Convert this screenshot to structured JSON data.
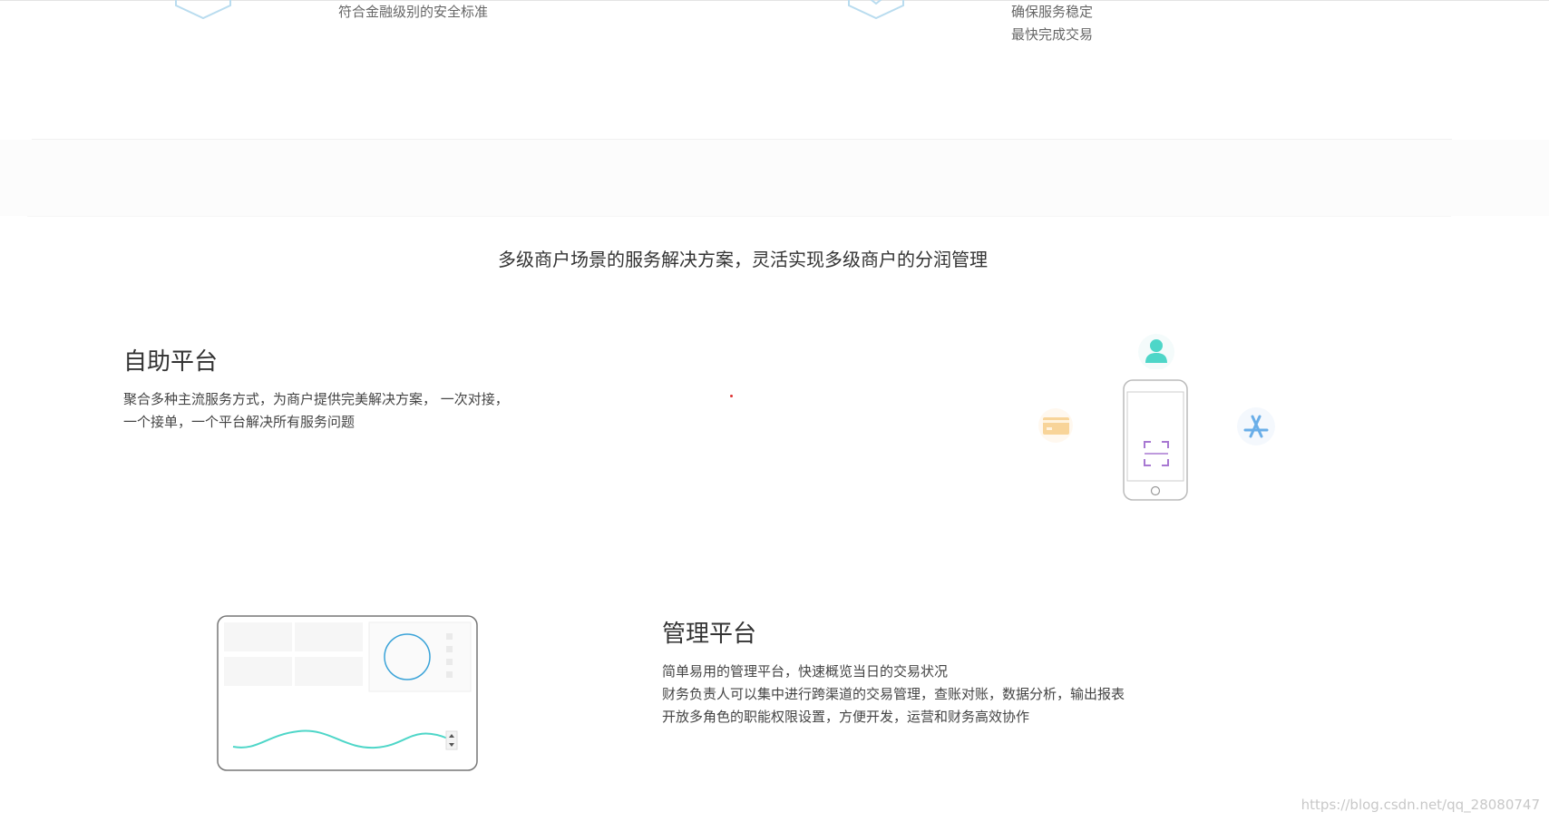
{
  "top": {
    "left_text": "符合金融级别的安全标准",
    "right_lines": [
      "确保服务稳定",
      "最快完成交易"
    ]
  },
  "subtitle": "多级商户场景的服务解决方案，灵活实现多级商户的分润管理",
  "self_service": {
    "title": "自助平台",
    "lines": [
      "聚合多种主流服务方式，为商户提供完美解决方案， 一次对接，",
      "一个接单，一个平台解决所有服务问题"
    ]
  },
  "management": {
    "title": "管理平台",
    "lines": [
      "简单易用的管理平台，快速概览当日的交易状况",
      "财务负责人可以集中进行跨渠道的交易管理，查账对账，数据分析，输出报表",
      "开放多角色的职能权限设置，方便开发，运营和财务高效协作"
    ]
  },
  "icons": {
    "top_left": "hexagon-shield-icon",
    "top_right": "hexagon-shield-icon",
    "user": "user-icon",
    "card": "card-icon",
    "phone": "phone-icon",
    "scan": "scan-icon",
    "app_store": "app-store-icon",
    "dashboard": "dashboard-illustration"
  },
  "colors": {
    "accent_blue": "#3aa3d8",
    "teal": "#4ed6c8",
    "card_orange": "#f5c47a",
    "app_blue": "#6aaee8",
    "scan_purple": "#b07ad0"
  },
  "watermark": "https://blog.csdn.net/qq_28080747"
}
